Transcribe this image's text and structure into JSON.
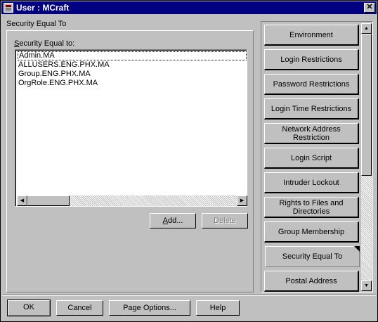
{
  "window": {
    "title": "User : MCraft",
    "close_glyph": "✕"
  },
  "section_title": "Security Equal To",
  "list": {
    "label": "Security Equal to:",
    "items": [
      "Admin.MA",
      "ALLUSERS.ENG.PHX.MA",
      "Group.ENG.PHX.MA",
      "OrgRole.ENG.PHX.MA"
    ]
  },
  "buttons": {
    "add": "Add...",
    "delete": "Delete",
    "ok": "OK",
    "cancel": "Cancel",
    "page_options": "Page Options...",
    "help": "Help"
  },
  "tabs": [
    {
      "label": "Environment",
      "active": false
    },
    {
      "label": "Login Restrictions",
      "active": false
    },
    {
      "label": "Password Restrictions",
      "active": false
    },
    {
      "label": "Login Time Restrictions",
      "active": false
    },
    {
      "label": "Network Address Restriction",
      "active": false
    },
    {
      "label": "Login Script",
      "active": false
    },
    {
      "label": "Intruder Lockout",
      "active": false
    },
    {
      "label": "Rights to Files and Directories",
      "active": false
    },
    {
      "label": "Group Membership",
      "active": false
    },
    {
      "label": "Security Equal To",
      "active": true
    },
    {
      "label": "Postal Address",
      "active": false
    }
  ],
  "icons": {
    "window_icon": "user-window-icon",
    "scroll_left": "◀",
    "scroll_right": "▶",
    "scroll_up": "▲",
    "scroll_down": "▼"
  },
  "colors": {
    "titlebar": "#000080",
    "face": "#c0c0c0"
  }
}
